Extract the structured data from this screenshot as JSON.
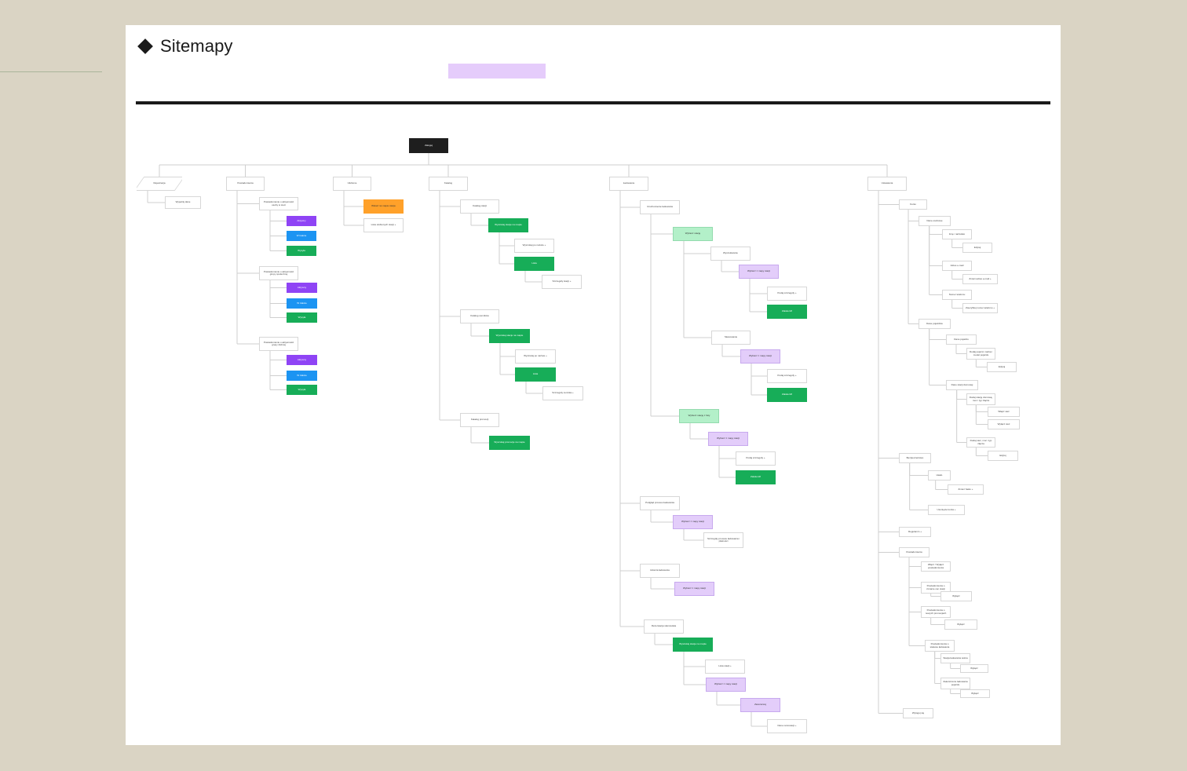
{
  "page": {
    "title": "Sitemapy"
  },
  "colors": {
    "canvas": "#dad4c4",
    "board": "#ffffff",
    "root": "#1e1e1e",
    "green": "#17ad58",
    "light_green": "#b3f0c9",
    "purple": "#8f44f5",
    "blue": "#1c94f2",
    "light_purple": "#e3cdfa",
    "orange": "#ffa12a",
    "connector": "#cfcfcf"
  },
  "sitemap": {
    "root": "Zaloguj",
    "nodes": [
      {
        "id": "n-rej",
        "label": "Rejestracja",
        "style": "para"
      },
      {
        "id": "n-rej-1",
        "label": "Wypełnij dane",
        "style": "white"
      },
      {
        "id": "n-pow",
        "label": "Powiadomienia",
        "style": "white"
      },
      {
        "id": "n-pow-1",
        "label": "Powiadomienie o aktywności osoby w sieci",
        "style": "white"
      },
      {
        "id": "n-pow-1a",
        "label": "Aktywny",
        "style": "purple"
      },
      {
        "id": "n-pow-1b",
        "label": "W trakcie",
        "style": "blue"
      },
      {
        "id": "n-pow-1c",
        "label": "Wysyła",
        "style": "green"
      },
      {
        "id": "n-pow-2",
        "label": "Powiadomienie o aktywności grupy społecznej",
        "style": "white"
      },
      {
        "id": "n-pow-2a",
        "label": "Aktywny",
        "style": "purple"
      },
      {
        "id": "n-pow-2b",
        "label": "W trakcie",
        "style": "blue"
      },
      {
        "id": "n-pow-2c",
        "label": "Wysyła",
        "style": "green"
      },
      {
        "id": "n-pow-3",
        "label": "Powiadomienie o aktywności grupy ślubnej",
        "style": "white"
      },
      {
        "id": "n-pow-3a",
        "label": "Aktywny",
        "style": "purple"
      },
      {
        "id": "n-pow-3b",
        "label": "W trakcie",
        "style": "blue"
      },
      {
        "id": "n-pow-3c",
        "label": "Wysyła",
        "style": "green"
      },
      {
        "id": "n-ulu",
        "label": "Ulubione",
        "style": "white"
      },
      {
        "id": "n-ulu-1",
        "label": "Wskaż na mapie stacje",
        "style": "orange"
      },
      {
        "id": "n-ulu-2",
        "label": "Lista ulubionych stacji +",
        "style": "white"
      },
      {
        "id": "n-kat",
        "label": "Katalog",
        "style": "white"
      },
      {
        "id": "n-kat-1",
        "label": "Katalog stacji",
        "style": "white"
      },
      {
        "id": "n-kat-1a",
        "label": "Wyszukaj stacje na mapie",
        "style": "green"
      },
      {
        "id": "n-kat-1b",
        "label": "Wyszukaj po nazwie +",
        "style": "white"
      },
      {
        "id": "n-kat-1c",
        "label": "Lista",
        "style": "green"
      },
      {
        "id": "n-kat-1d",
        "label": "Szczegóły stacji +",
        "style": "white"
      },
      {
        "id": "n-kat-2",
        "label": "Katalog cenników",
        "style": "white"
      },
      {
        "id": "n-kat-2a",
        "label": "Wyszukaj stacje na mapie",
        "style": "green"
      },
      {
        "id": "n-kat-2b",
        "label": "Wyszukaj po nazwie +",
        "style": "white"
      },
      {
        "id": "n-kat-2c",
        "label": "Lista",
        "style": "green"
      },
      {
        "id": "n-kat-2d",
        "label": "Szczegóły cennika +",
        "style": "white"
      },
      {
        "id": "n-kat-3",
        "label": "Katalog promocji",
        "style": "white"
      },
      {
        "id": "n-kat-3a",
        "label": "Wyszukaj promocje na mapie",
        "style": "green"
      },
      {
        "id": "n-lad",
        "label": "Ładowanie",
        "style": "white"
      },
      {
        "id": "n-lad-1",
        "label": "Uruchomienie ładowania",
        "style": "white"
      },
      {
        "id": "n-lad-1a",
        "label": "Wybierz stację",
        "style": "lgreen"
      },
      {
        "id": "n-lad-1a1",
        "label": "Wyszukiwanie",
        "style": "white"
      },
      {
        "id": "n-lad-1a1a",
        "label": "Wybierz z mapy stacji",
        "style": "lpurple"
      },
      {
        "id": "n-lad-1a1b",
        "label": "Podaj szczegóły +",
        "style": "white"
      },
      {
        "id": "n-lad-1a1c",
        "label": "Zatwierdź",
        "style": "green"
      },
      {
        "id": "n-lad-1a2",
        "label": "Skanowanie",
        "style": "white"
      },
      {
        "id": "n-lad-1a2a",
        "label": "Wybierz z mapy stacji",
        "style": "lpurple"
      },
      {
        "id": "n-lad-1a2b",
        "label": "Podaj szczegóły +",
        "style": "white"
      },
      {
        "id": "n-lad-1a2c",
        "label": "Zatwierdź",
        "style": "green"
      },
      {
        "id": "n-lad-1b",
        "label": "Wybierz stację z listy",
        "style": "lgreen"
      },
      {
        "id": "n-lad-1b1",
        "label": "Wybierz z mapy stacji",
        "style": "lpurple"
      },
      {
        "id": "n-lad-1b2",
        "label": "Podaj szczegóły +",
        "style": "white"
      },
      {
        "id": "n-lad-1b3",
        "label": "Zatwierdź",
        "style": "green"
      },
      {
        "id": "n-lad-2",
        "label": "Podgląd procesu ładowania",
        "style": "white"
      },
      {
        "id": "n-lad-2a",
        "label": "Wybierz z mapy stacji",
        "style": "lpurple"
      },
      {
        "id": "n-lad-2b",
        "label": "Szczegóły procesu ładowania i płatności",
        "style": "white"
      },
      {
        "id": "n-lad-3",
        "label": "Historia ładowania",
        "style": "white"
      },
      {
        "id": "n-lad-3a",
        "label": "Wybierz z mapy stacji",
        "style": "lpurple"
      },
      {
        "id": "n-lad-4",
        "label": "Rezerwacja stanowiska",
        "style": "white"
      },
      {
        "id": "n-lad-4a",
        "label": "Wyszukaj stacje na mapie",
        "style": "green"
      },
      {
        "id": "n-lad-4b",
        "label": "Lista stacji +",
        "style": "white"
      },
      {
        "id": "n-lad-4c",
        "label": "Wybierz z mapy stacji",
        "style": "lpurple"
      },
      {
        "id": "n-lad-4d",
        "label": "Zarezerwuj",
        "style": "lpurple"
      },
      {
        "id": "n-lad-4e",
        "label": "Dane rezerwacji +",
        "style": "white"
      },
      {
        "id": "n-ust",
        "label": "Ustawienia",
        "style": "white"
      },
      {
        "id": "n-ust-1",
        "label": "Konto",
        "style": "white"
      },
      {
        "id": "n-ust-1a",
        "label": "Dane osobowe",
        "style": "white"
      },
      {
        "id": "n-ust-1a1",
        "label": "Imię i nazwisko",
        "style": "white"
      },
      {
        "id": "n-ust-1a1a",
        "label": "Edytuj",
        "style": "white"
      },
      {
        "id": "n-ust-1a2",
        "label": "Adres e-mail",
        "style": "white"
      },
      {
        "id": "n-ust-1a2a",
        "label": "Zmień adres e-mail +",
        "style": "white"
      },
      {
        "id": "n-ust-1a3",
        "label": "Numer telefonu",
        "style": "white"
      },
      {
        "id": "n-ust-1a3a",
        "label": "Zweryfikuj numer telefonu +",
        "style": "white"
      },
      {
        "id": "n-ust-1b",
        "label": "Dane pojazdów",
        "style": "white"
      },
      {
        "id": "n-ust-1b1",
        "label": "Dane pojazdu",
        "style": "white"
      },
      {
        "id": "n-ust-1b1a",
        "label": "Dodaj pojazd, marka i model pojazdu",
        "style": "white"
      },
      {
        "id": "n-ust-1b1b",
        "label": "Edytuj",
        "style": "white"
      },
      {
        "id": "n-ust-1b2",
        "label": "Dane stacji domowej",
        "style": "white"
      },
      {
        "id": "n-ust-1b2a",
        "label": "Dodaj stację domową, moc i typ złącza",
        "style": "white"
      },
      {
        "id": "n-ust-1b2a1",
        "label": "Włącz sieć",
        "style": "white"
      },
      {
        "id": "n-ust-1b2a2",
        "label": "Wyłącz sieć",
        "style": "white"
      },
      {
        "id": "n-ust-1b2b",
        "label": "Dodaj sieć, moc i typ złącza",
        "style": "white"
      },
      {
        "id": "n-ust-1b2b1",
        "label": "Edytuj",
        "style": "white"
      },
      {
        "id": "n-ust-2",
        "label": "Bezpieczeństwo",
        "style": "white"
      },
      {
        "id": "n-ust-2a",
        "label": "Hasło",
        "style": "white"
      },
      {
        "id": "n-ust-2a1",
        "label": "Zmień hasło +",
        "style": "white"
      },
      {
        "id": "n-ust-2b",
        "label": "Usunięcie konta +",
        "style": "white"
      },
      {
        "id": "n-ust-3",
        "label": "Regulamin +",
        "style": "white"
      },
      {
        "id": "n-ust-4",
        "label": "Powiadomienia",
        "style": "white"
      },
      {
        "id": "n-ust-4a",
        "label": "Włącz / Wyłącz powiadomienia",
        "style": "white"
      },
      {
        "id": "n-ust-4b",
        "label": "Powiadomienia o zmianie cen stacji",
        "style": "white"
      },
      {
        "id": "n-ust-4b1",
        "label": "Wyłącz",
        "style": "white"
      },
      {
        "id": "n-ust-4c",
        "label": "Powiadomienia o nowych promocjach",
        "style": "white"
      },
      {
        "id": "n-ust-4c1",
        "label": "Wyłącz",
        "style": "white"
      },
      {
        "id": "n-ust-4d",
        "label": "Powiadomienia o statusie ładowania",
        "style": "white"
      },
      {
        "id": "n-ust-4d1",
        "label": "Stacja ładowania wolna",
        "style": "white"
      },
      {
        "id": "n-ust-4d1a",
        "label": "Wyłącz",
        "style": "white"
      },
      {
        "id": "n-ust-4d2",
        "label": "Zakończenie ładowania pojazdu",
        "style": "white"
      },
      {
        "id": "n-ust-4d2a",
        "label": "Wyłącz",
        "style": "white"
      },
      {
        "id": "n-ust-5",
        "label": "Wyloguj się",
        "style": "white"
      }
    ]
  }
}
